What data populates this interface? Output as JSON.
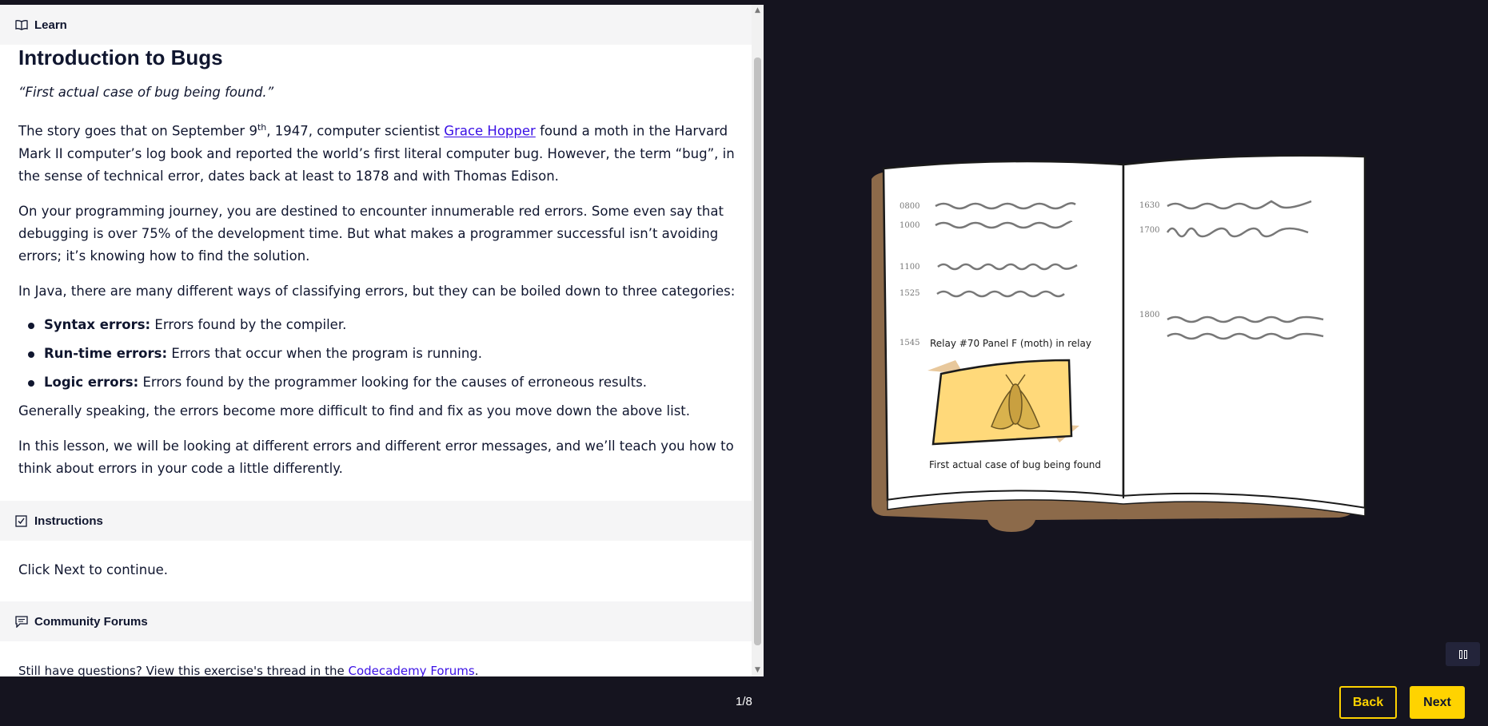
{
  "learn": {
    "header": "Learn",
    "title": "Introduction to Bugs",
    "quote": "“First actual case of bug being found.”",
    "p1": {
      "before": "The story goes that on September 9",
      "sup": "th",
      "mid": ", 1947, computer scientist ",
      "link": "Grace Hopper",
      "after": " found a moth in the Harvard Mark II computer’s log book and reported the world’s first literal computer bug. However, the term “bug”, in the sense of technical error, dates back at least to 1878 and with Thomas Edison."
    },
    "p2": "On your programming journey, you are destined to encounter innumerable red errors. Some even say that debugging is over 75% of the development time. But what makes a programmer successful isn’t avoiding errors; it’s knowing how to find the solution.",
    "p3": "In Java, there are many different ways of classifying errors, but they can be boiled down to three categories:",
    "list": [
      {
        "term": "Syntax errors:",
        "desc": " Errors found by the compiler."
      },
      {
        "term": "Run-time errors:",
        "desc": " Errors that occur when the program is running."
      },
      {
        "term": "Logic errors:",
        "desc": " Errors found by the programmer looking for the causes of erroneous results."
      }
    ],
    "p4": "Generally speaking, the errors become more difficult to find and fix as you move down the above list.",
    "p5": "In this lesson, we will be looking at different errors and different error messages, and we’ll teach you how to think about errors in your code a little differently."
  },
  "instructions": {
    "header": "Instructions",
    "text": "Click Next to continue."
  },
  "forums": {
    "header": "Community Forums",
    "text_before": "Still have questions? View this exercise's thread in the ",
    "link": "Codecademy Forums",
    "text_after": "."
  },
  "illustration": {
    "left_times": [
      "0800",
      "1000",
      "1100",
      "1525",
      "1545"
    ],
    "right_times": [
      "1630",
      "1700",
      "1800"
    ],
    "relay_note": "Relay #70  Panel F (moth) in relay",
    "caption": "First actual case of bug being found"
  },
  "footer": {
    "counter": "1/8",
    "back_label": "Back",
    "next_label": "Next"
  },
  "colors": {
    "accent": "#ffd300",
    "link": "#3a10e5",
    "dark": "#15141f",
    "text": "#10162f"
  }
}
